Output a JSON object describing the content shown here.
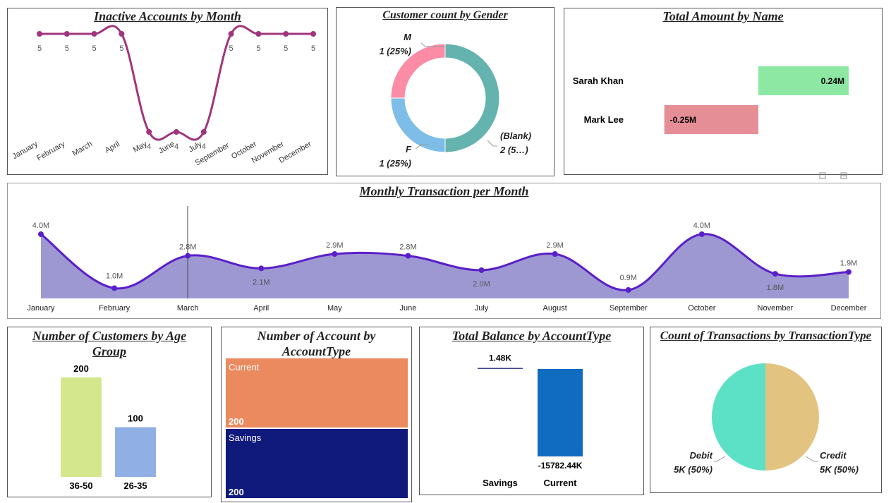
{
  "colors": {
    "inactive_line": "#A0357D",
    "area_fill": "#9E98D2",
    "area_line": "#5A1FC9",
    "gender_m": "#FC8BA6",
    "gender_f": "#7DBDE7",
    "gender_blank": "#65B3AE",
    "amount_pos": "#8CE8A3",
    "amount_neg": "#E68E96",
    "age_36_50": "#D4E78C",
    "age_26_35": "#90B0E5",
    "acct_current": "#EA8A5E",
    "acct_savings": "#101A7C",
    "bal_savings": "#3D3F8F",
    "bal_current": "#0F6CC0",
    "txn_debit": "#5CE0C6",
    "txn_credit": "#E3C380"
  },
  "chart_data": [
    {
      "id": "inactive",
      "type": "line",
      "title": "Inactive Accounts by Month",
      "categories": [
        "January",
        "February",
        "March",
        "April",
        "May",
        "June",
        "July",
        "September",
        "October",
        "November",
        "December"
      ],
      "values": [
        5,
        5,
        5,
        5,
        4,
        4,
        4,
        5,
        5,
        5,
        5
      ],
      "ylim": [
        3.9,
        5.1
      ]
    },
    {
      "id": "gender",
      "type": "pie",
      "title": "Customer count by Gender",
      "labels": [
        "(Blank)",
        "F",
        "M"
      ],
      "values": [
        2,
        1,
        1
      ],
      "slice_labels": [
        "2 (5…)",
        "1 (25%)",
        "1 (25%)"
      ]
    },
    {
      "id": "amount",
      "type": "bar",
      "title": "Total Amount by Name",
      "categories": [
        "Sarah Khan",
        "Mark Lee"
      ],
      "values": [
        0.24,
        -0.25
      ],
      "value_labels": [
        "0.24M",
        "-0.25M"
      ]
    },
    {
      "id": "monthly",
      "type": "area",
      "title": "Monthly Transaction per Month",
      "categories": [
        "January",
        "February",
        "March",
        "April",
        "May",
        "June",
        "July",
        "August",
        "September",
        "October",
        "November",
        "December"
      ],
      "values": [
        4.0,
        1.0,
        2.8,
        2.1,
        2.9,
        2.8,
        2.0,
        2.9,
        0.9,
        4.0,
        1.8,
        1.9
      ],
      "value_labels": [
        "4.0M",
        "1.0M",
        "2.8M",
        "2.1M",
        "2.9M",
        "2.8M",
        "2.0M",
        "2.9M",
        "0.9M",
        "4.0M",
        "1.8M",
        "1.9M"
      ],
      "ylim": [
        -3.5,
        4.5
      ]
    },
    {
      "id": "age",
      "type": "bar",
      "title": "Number of Customers by Age Group",
      "categories": [
        "36-50",
        "26-35"
      ],
      "values": [
        200,
        100
      ],
      "ylim": [
        0,
        200
      ]
    },
    {
      "id": "accttype",
      "type": "bar",
      "title": "Number of Account by AccountType",
      "categories": [
        "Current",
        "Savings"
      ],
      "values": [
        200,
        200
      ]
    },
    {
      "id": "balance",
      "type": "bar",
      "title": "Total Balance by AccountType",
      "categories": [
        "Savings",
        "Current"
      ],
      "values": [
        1.48,
        -15782.44
      ],
      "value_labels": [
        "1.48K",
        "-15782.44K"
      ]
    },
    {
      "id": "txntype",
      "type": "pie",
      "title": "Count of Transactions by TransactionType",
      "labels": [
        "Credit",
        "Debit"
      ],
      "values": [
        5,
        5
      ],
      "slice_labels": [
        "5K (50%)",
        "5K (50%)"
      ]
    }
  ]
}
